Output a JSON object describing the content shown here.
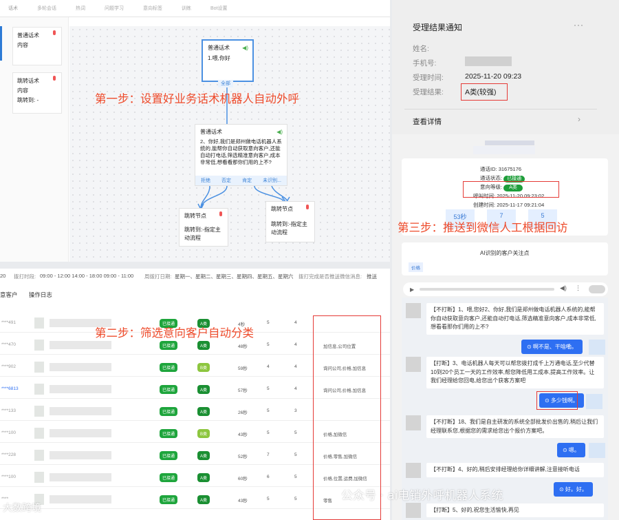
{
  "flow_editor": {
    "top_nav": [
      "话术",
      "多轮会话",
      "热词",
      "问题学习",
      "意向标签",
      "训练",
      "Bot设置"
    ],
    "side_cards": [
      {
        "lines": [
          "普通话术",
          "内容"
        ]
      },
      {
        "lines": [
          "跳转话术",
          "内容",
          "跳转到: -"
        ]
      }
    ],
    "node1": {
      "title": "普通话术",
      "text": "1.喂,你好",
      "tag": "全部"
    },
    "node2": {
      "title": "普通话术",
      "text": "2、你好,我们是郑州做电话机器人系统的,能帮你自动获取意向客户,还能自动打电话,筛选精准意向客户,成本非常低,想看看那你们用的上不?",
      "tags": [
        "拒绝",
        "否定",
        "肯定",
        "未识别..."
      ]
    },
    "jump_nodes": [
      {
        "title": "跳转节点",
        "text": "跳转到:-指定主动流程"
      },
      {
        "title": "跳转节点",
        "text": "跳转到:-指定主动流程"
      }
    ]
  },
  "annotations": {
    "step1": "第一步：设置好业务话术机器人自动外呼",
    "step2": "第二步：筛选意向客户自动分类",
    "step3": "第三步：推送到微信人工根据回访"
  },
  "notification": {
    "title": "受理结果通知",
    "more": "···",
    "name_label": "姓名:",
    "phone_label": "手机号:",
    "time_label": "受理时间:",
    "time_value": "2025-11-20 09:23",
    "result_label": "受理结果:",
    "result_value": "A类(较强)",
    "detail_label": "查看详情",
    "chevron": "›"
  },
  "call_record": {
    "call_id_label": "通话ID:",
    "call_id": "31675176",
    "status_label": "通话状态:",
    "status": "已接通",
    "intent_label": "意向等级:",
    "intent": "A类",
    "call_time_label": "呼叫时间:",
    "call_time": "2025-11-20 09:23:02",
    "created_label": "创建时间:",
    "created": "2025-11-17 09:21:04",
    "stats": [
      "53秒",
      "7",
      "5"
    ],
    "focus_title": "AI识别的客户关注点",
    "focus_tag": "价格"
  },
  "chat": [
    {
      "role": "bot",
      "text": "【不打断】1、喂,您好2、你好,我们是郑州做电话机器人系统的,能帮你自动获取意向客户,还能自动打电话,筛选精准意向客户,成本非常低,想看看那你们用的上不?"
    },
    {
      "role": "user",
      "text": "⊙ 啊不是、干啥嘞。"
    },
    {
      "role": "bot",
      "text": "【打断】3、电话机器人每天可以帮您拨打成千上万通电话,至少代替10到20个员工一天的工作效率,帮您降低用工成本,提高工作效率。让我们经理给您回电,给您出个获客方案吧"
    },
    {
      "role": "user",
      "text": "⊙ 多少钱啊。"
    },
    {
      "role": "bot",
      "text": "【不打断】18、我们是自主研发的系统全部批发价出售的,稍后让我们经理联系您,根据您的需求给您出个报价方案吧。"
    },
    {
      "role": "user",
      "text": "⊙ 嗯。"
    },
    {
      "role": "bot",
      "text": "【不打断】4、好的,稍后安排经理给你详细讲解,注意接听电话"
    },
    {
      "role": "user",
      "text": "⊙ 好。好。"
    },
    {
      "role": "bot",
      "text": "【打断】5、好的,祝您生活愉快,再见"
    }
  ],
  "table": {
    "time_row": {
      "prefix": "20",
      "allowed_label": "拨打时段:",
      "allowed_value": "09:00 - 12:00 14:00 - 18:00 09:00 - 11:00",
      "days_label": "周拨打日期:",
      "days_value": "星期一、星期二、星期三、星期四、星期五、星期六",
      "push_label": "拨打完成是否推送微信消息:",
      "push_value": "推送"
    },
    "tabs": [
      "意客户",
      "操作日志"
    ],
    "rows": [
      {
        "phone": "****491",
        "status": "已接通",
        "cls": "A类",
        "type": "a",
        "dur": "4秒",
        "n1": "5",
        "n2": "4",
        "note": ""
      },
      {
        "phone": "****470",
        "status": "已接通",
        "cls": "A类",
        "type": "a",
        "dur": "48秒",
        "n1": "5",
        "n2": "4",
        "note": "加信息,公司位置"
      },
      {
        "phone": "****902",
        "status": "已接通",
        "cls": "B类",
        "type": "b",
        "dur": "59秒",
        "n1": "4",
        "n2": "4",
        "note": "询问公司,价格,加信息"
      },
      {
        "phone": "****6813",
        "status": "已接通",
        "cls": "A类",
        "type": "a",
        "dur": "57秒",
        "n1": "5",
        "n2": "4",
        "note": "询问公司,价格,加信息"
      },
      {
        "phone": "****133",
        "status": "已接通",
        "cls": "A类",
        "type": "a",
        "dur": "26秒",
        "n1": "5",
        "n2": "3",
        "note": ""
      },
      {
        "phone": "****100",
        "status": "已接通",
        "cls": "B类",
        "type": "b",
        "dur": "43秒",
        "n1": "5",
        "n2": "5",
        "note": "价格,加微信"
      },
      {
        "phone": "****228",
        "status": "已接通",
        "cls": "A类",
        "type": "a",
        "dur": "52秒",
        "n1": "7",
        "n2": "5",
        "note": "价格,零售,加微信"
      },
      {
        "phone": "****100",
        "status": "已接通",
        "cls": "A类",
        "type": "a",
        "dur": "60秒",
        "n1": "6",
        "n2": "5",
        "note": "价格,位置,运费,加微信"
      },
      {
        "phone": "****",
        "status": "已接通",
        "cls": "A类",
        "type": "a",
        "dur": "43秒",
        "n1": "5",
        "n2": "5",
        "note": "零售"
      }
    ]
  },
  "watermarks": {
    "left": "大数跨境",
    "right": "公众号 · ai电销外呼机器人系统"
  },
  "colors": {
    "annotation_red": "#ee4b2b",
    "highlight_box": "#e53935",
    "user_bubble": "#2e6ff2",
    "connected_green": "#1ea53c"
  }
}
